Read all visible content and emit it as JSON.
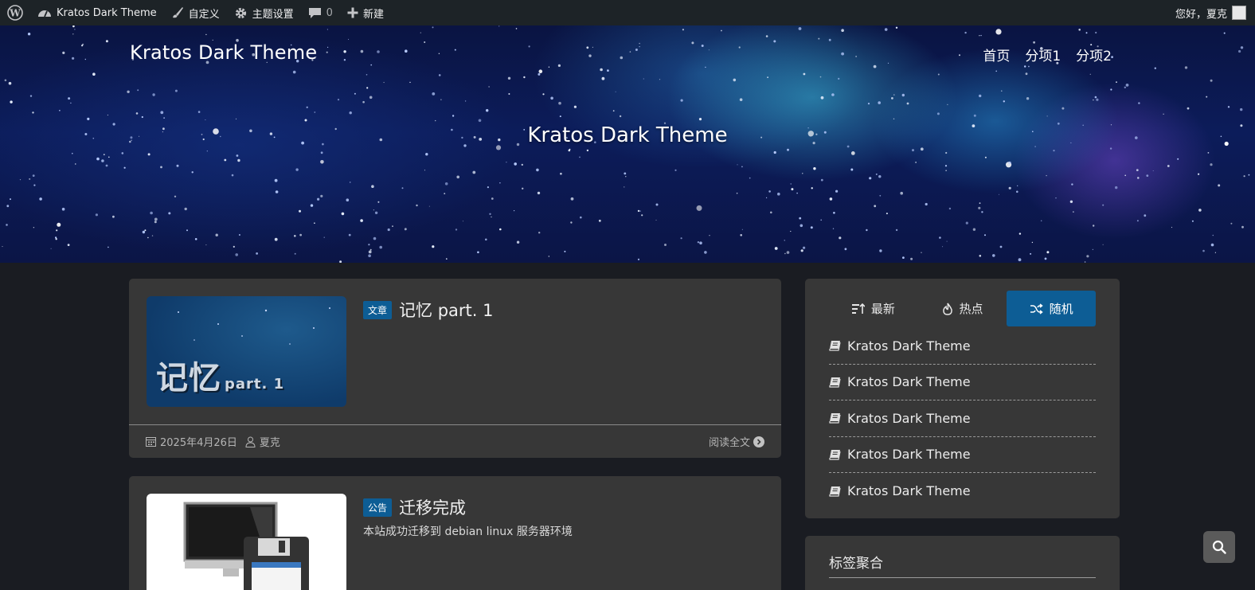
{
  "adminbar": {
    "site_name": "Kratos Dark Theme",
    "customize": "自定义",
    "theme_settings": "主题设置",
    "comments_count": "0",
    "new": "新建",
    "greeting": "您好，夏克"
  },
  "header": {
    "site_title": "Kratos Dark Theme",
    "nav": [
      "首页",
      "分项1",
      "分项2"
    ],
    "hero_title": "Kratos Dark Theme"
  },
  "posts": [
    {
      "badge": "文章",
      "title": "记忆 part. 1",
      "thumb_text_big": "记忆",
      "thumb_text_small": "part. 1",
      "date": "2025年4月26日",
      "author": "夏克",
      "read_more": "阅读全文"
    },
    {
      "badge": "公告",
      "title": "迁移完成",
      "excerpt": "本站成功迁移到 debian linux 服务器环境"
    }
  ],
  "sidebar": {
    "tabs": [
      {
        "label": "最新",
        "icon": "sort-icon"
      },
      {
        "label": "热点",
        "icon": "fire-icon"
      },
      {
        "label": "随机",
        "icon": "shuffle-icon",
        "active": true
      }
    ],
    "items": [
      "Kratos Dark Theme",
      "Kratos Dark Theme",
      "Kratos Dark Theme",
      "Kratos Dark Theme",
      "Kratos Dark Theme"
    ],
    "tags_title": "标签聚合"
  },
  "colors": {
    "accent": "#0d5d95",
    "card": "#373737",
    "page_bg": "#1a1c22",
    "adminbar": "#1d2327"
  }
}
